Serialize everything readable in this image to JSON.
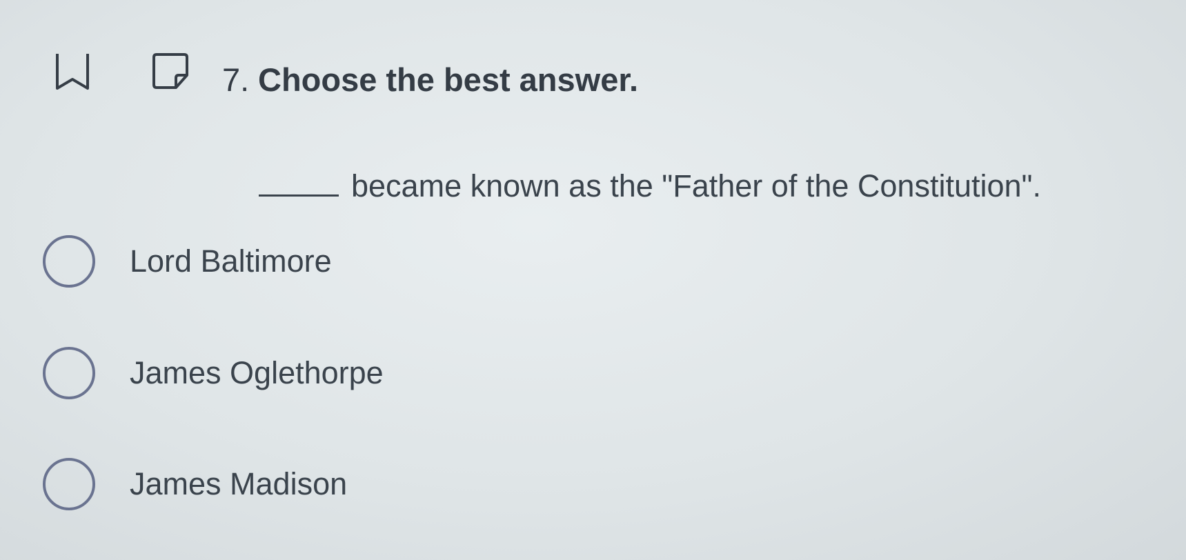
{
  "question": {
    "number": "7.",
    "instruction": "Choose the best answer.",
    "prompt_text": "became known as the \"Father of the Constitution\"."
  },
  "icons": {
    "bookmark": "bookmark-icon",
    "note": "note-icon"
  },
  "choices": [
    {
      "label": "Lord Baltimore"
    },
    {
      "label": "James Oglethorpe"
    },
    {
      "label": "James Madison"
    }
  ]
}
